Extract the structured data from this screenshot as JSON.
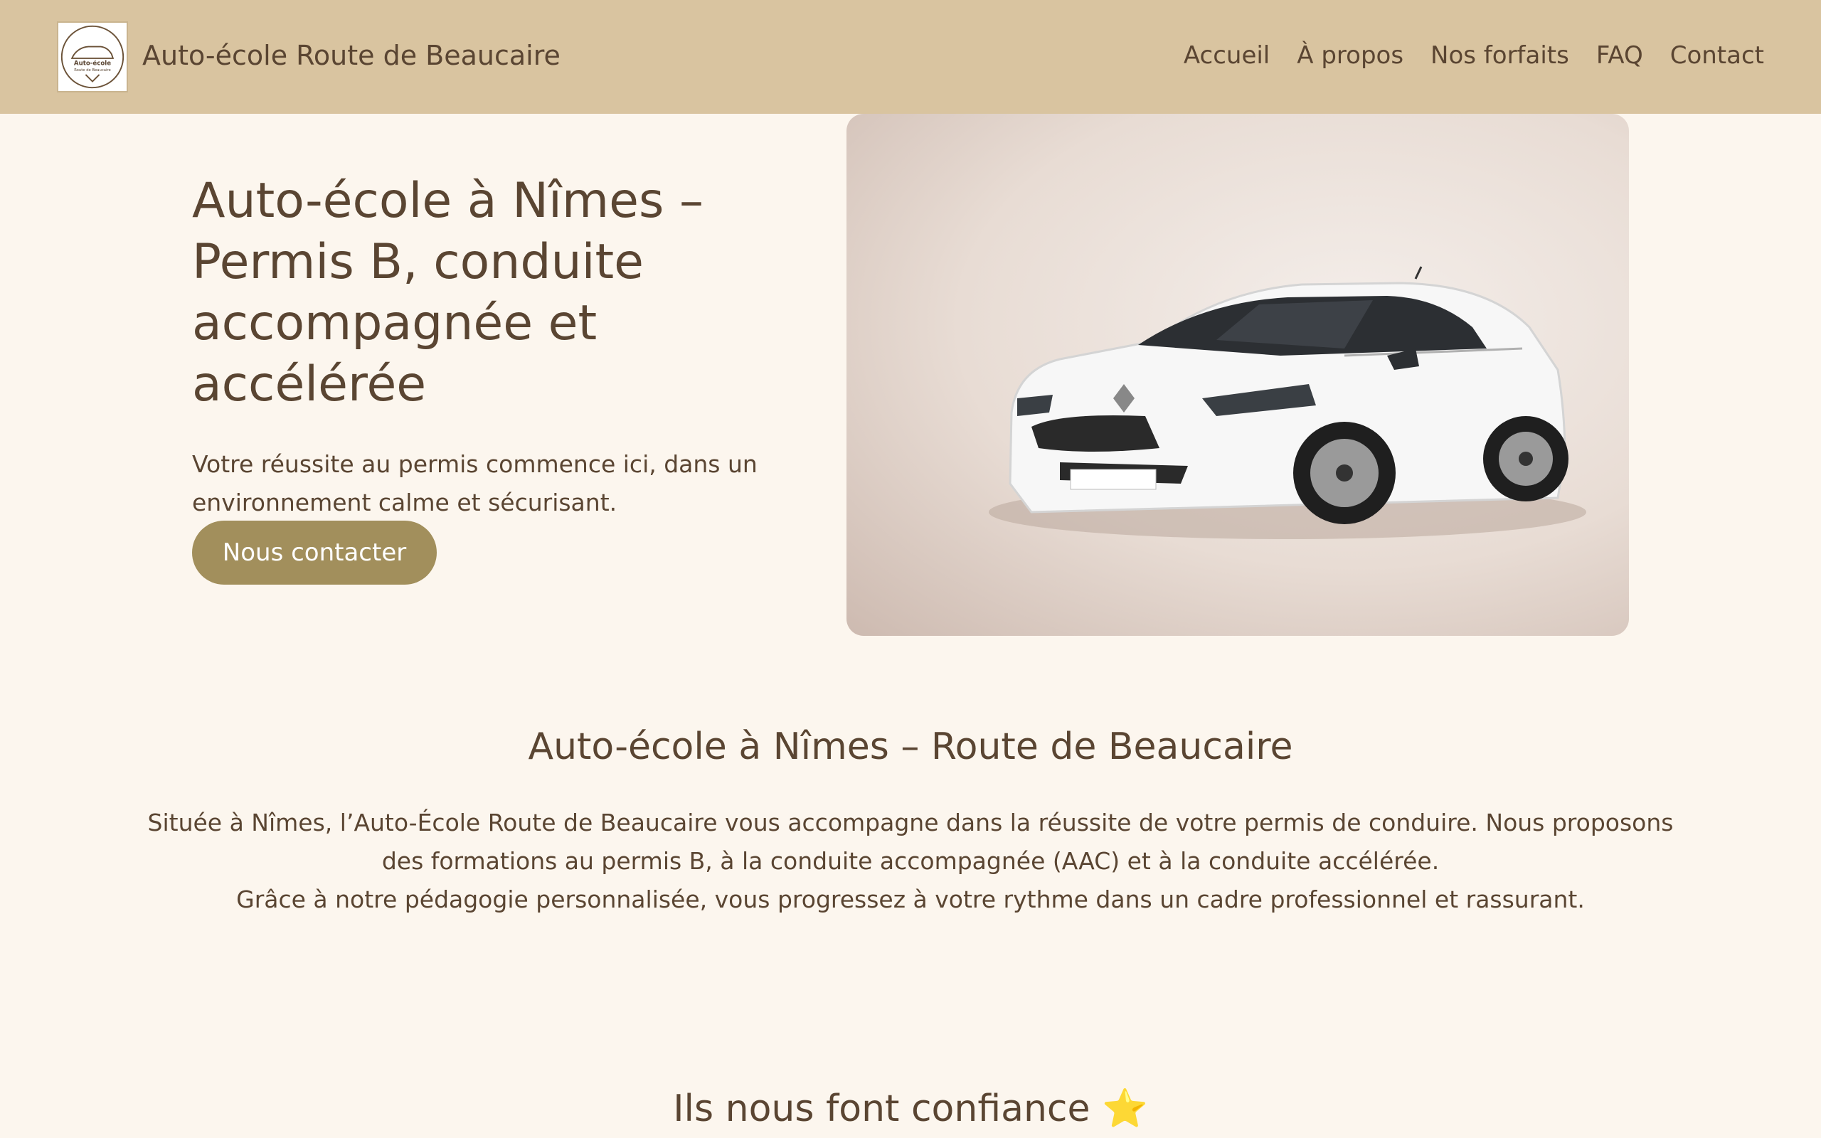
{
  "header": {
    "brand": "Auto-école Route de Beaucaire",
    "logo_text_line1": "Auto-école",
    "logo_text_line2": "Route de Beaucaire",
    "nav": [
      "Accueil",
      "À propos",
      "Nos forfaits",
      "FAQ",
      "Contact"
    ]
  },
  "hero": {
    "title": "Auto-école à Nîmes – Permis B, conduite accompagnée et accélérée",
    "subtitle": "Votre réussite au permis commence ici, dans un environnement calme et sécurisant.",
    "cta_label": "Nous contacter"
  },
  "about": {
    "title": "Auto-école à Nîmes – Route de Beaucaire",
    "line1": "Située à Nîmes, l’Auto-École Route de Beaucaire vous accompagne dans la réussite de votre permis de conduire. Nous proposons des formations au permis B, à la conduite accompagnée (AAC) et à la conduite accélérée.",
    "line2": "Grâce à notre pédagogie personnalisée, vous progressez à votre rythme dans un cadre professionnel et rassurant."
  },
  "trust": {
    "title": "Ils nous font confiance ⭐"
  },
  "colors": {
    "header_bg": "#d9c4a0",
    "page_bg": "#fcf6ee",
    "text": "#5a4532",
    "button": "#a28f5c"
  }
}
